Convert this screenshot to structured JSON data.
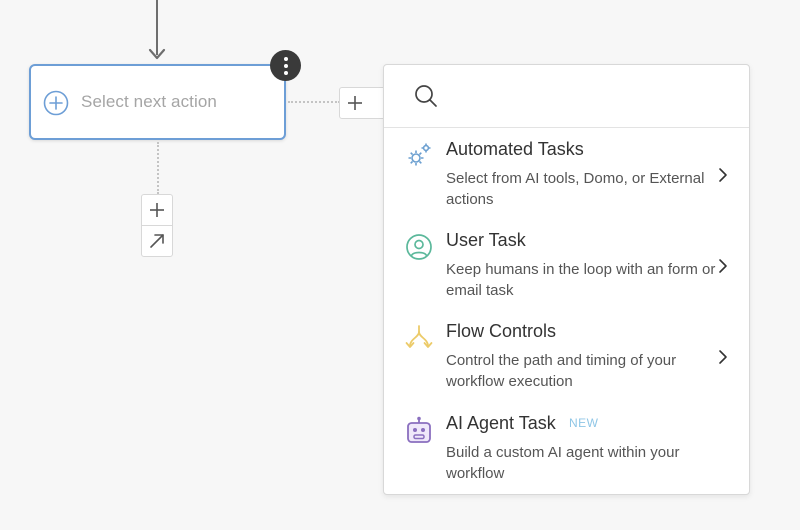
{
  "canvas": {
    "node": {
      "label": "Select next action",
      "add_icon": "plus-circle-icon",
      "menu_icon": "more-vertical-icon"
    },
    "connectors": {
      "right_add_icon": "plus-icon",
      "down_add_icon": "plus-icon",
      "down_jump_icon": "arrow-up-right-icon"
    }
  },
  "menu": {
    "search": {
      "placeholder": "",
      "value": "",
      "icon": "search-icon"
    },
    "items": [
      {
        "title": "Automated Tasks",
        "description": "Select from AI tools, Domo, or External actions",
        "icon": "gears-icon",
        "icon_color": "#6b9fd0",
        "has_submenu": true
      },
      {
        "title": "User Task",
        "description": "Keep humans in the loop with an form or email task",
        "icon": "user-circle-icon",
        "icon_color": "#5bb89b",
        "has_submenu": true
      },
      {
        "title": "Flow Controls",
        "description": "Control the path and timing of your workflow execution",
        "icon": "branch-icon",
        "icon_color": "#eccb6a",
        "has_submenu": true
      },
      {
        "title": "AI Agent Task",
        "badge": "NEW",
        "description": "Build a custom AI agent within your workflow",
        "icon": "robot-icon",
        "icon_color": "#8a6fbf",
        "has_submenu": false
      }
    ]
  },
  "colors": {
    "node_border": "#6d9ed6",
    "badge_new": "#8fc6e6",
    "kebab_bg": "#3a3a3a"
  }
}
